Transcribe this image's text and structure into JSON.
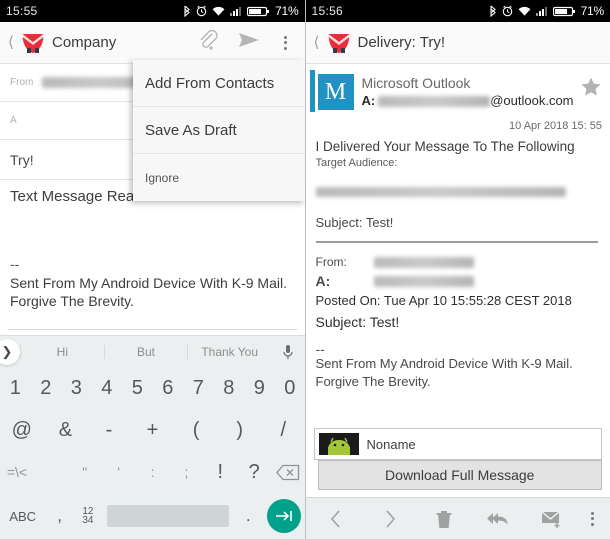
{
  "left": {
    "status": {
      "clock": "15:55",
      "battery": "71%",
      "icons": [
        "bluetooth-icon",
        "alarm-icon",
        "wifi-icon",
        "signal-icon",
        "battery-icon"
      ]
    },
    "appbar": {
      "title": "Company",
      "back": "back-chevron-icon",
      "actions": [
        "attach-icon",
        "send-icon",
        "overflow-icon"
      ]
    },
    "compose": {
      "from_label": "From",
      "from_value": "",
      "to_label": "A",
      "to_value": "",
      "subject_label": "",
      "subject_value": "Try!",
      "body_line": "Text Message Read Notification",
      "signature_dash": "--",
      "signature": "Sent From My Android Device With K-9 Mail. Forgive The Brevity."
    },
    "menu": {
      "items": [
        {
          "label": "Add From Contacts",
          "size": "normal"
        },
        {
          "label": "Save As Draft",
          "size": "normal"
        },
        {
          "label": "Ignore",
          "size": "small"
        }
      ]
    },
    "keyboard": {
      "suggestions": [
        "Hi",
        "But",
        "Thank You"
      ],
      "expand_icon": "chevron-right-icon",
      "mic_icon": "microphone-icon",
      "row_numbers": [
        "1",
        "2",
        "3",
        "4",
        "5",
        "6",
        "7",
        "8",
        "9",
        "0"
      ],
      "row_symbols": [
        "@",
        "&",
        "-",
        "+",
        "(",
        ")",
        "/"
      ],
      "row_punct": [
        "=\\<",
        "",
        "\"",
        "'",
        ":",
        ";",
        "!",
        "?"
      ],
      "backspace_icon": "backspace-icon",
      "abc_key": "ABC",
      "comma_key": ",",
      "num_key": "1234",
      "space_key": "",
      "dot_key": ".",
      "enter_icon": "enter-arrow-icon"
    }
  },
  "right": {
    "status": {
      "clock": "15:56",
      "battery": "71%",
      "icons": [
        "bluetooth-icon",
        "alarm-icon",
        "wifi-icon",
        "signal-icon",
        "battery-icon"
      ]
    },
    "appbar": {
      "title": "Delivery: Try!",
      "back": "back-chevron-icon"
    },
    "message": {
      "avatar_letter": "M",
      "sender": "Microsoft Outlook",
      "to_label": "A:",
      "to_domain": "@outlook.com",
      "date": "10 Apr 2018 15: 55",
      "star_icon": "star-icon",
      "body_line1": "I Delivered Your Message To The Following",
      "body_line2": "Target Audience:",
      "subject_line": "Subject: Test!",
      "quoted": {
        "from_label": "From:",
        "to_label": "A:",
        "posted": "Posted On: Tue Apr 10 15:55:28 CEST 2018",
        "subject": "Subject: Test!"
      },
      "sig_dash": "--",
      "sig_line1": "Sent From My Android Device With K-9 Mail.",
      "sig_line2": "Forgive The Brevity.",
      "attachment_name": "Noname",
      "download_label": "Download Full Message"
    },
    "bottombar": {
      "icons": [
        "prev-icon",
        "next-icon",
        "delete-icon",
        "reply-all-icon",
        "new-mail-icon",
        "overflow-icon"
      ]
    }
  }
}
